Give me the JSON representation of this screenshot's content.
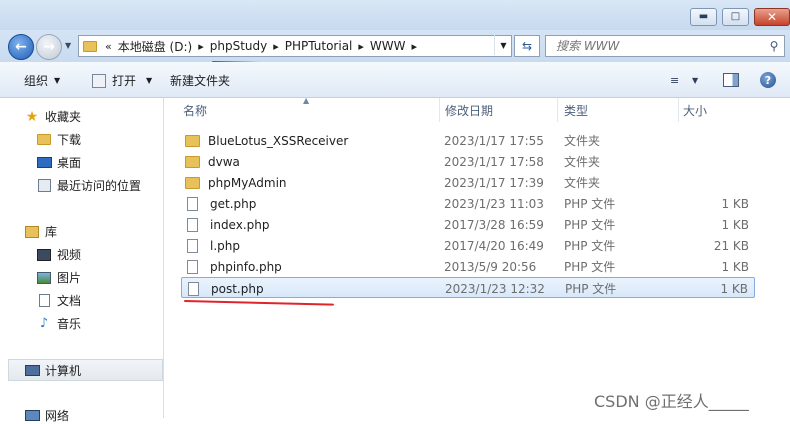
{
  "titlebar": {
    "buttons": {
      "minimize": "▬",
      "maximize": "□",
      "close": "✕"
    }
  },
  "nav": {
    "back_glyph": "←",
    "forward_glyph": "→",
    "recent_glyph": "▼",
    "crumbs_prefix": "«",
    "crumbs": [
      "本地磁盘 (D:)",
      "phpStudy",
      "PHPTutorial",
      "WWW"
    ],
    "crumb_separator": "▸",
    "dropdown_glyph": "▼",
    "refresh_glyph": "⇆"
  },
  "search": {
    "placeholder": "搜索 WWW",
    "icon": "search-icon",
    "icon_glyph": "⚲"
  },
  "toolbar": {
    "organize_label": "组织",
    "open_label": "打开",
    "new_folder_label": "新建文件夹",
    "dropdown_glyph": "▼",
    "view_glyph": "≡",
    "help_glyph": "?"
  },
  "sidebar": {
    "favorites": {
      "label": "收藏夹",
      "items": [
        "下载",
        "桌面",
        "最近访问的位置"
      ]
    },
    "libraries": {
      "label": "库",
      "items": [
        "视频",
        "图片",
        "文档",
        "音乐"
      ]
    },
    "computer": {
      "label": "计算机"
    },
    "network": {
      "label": "网络"
    }
  },
  "columns": {
    "name": "名称",
    "date": "修改日期",
    "type": "类型",
    "size": "大小",
    "sort_glyph": "▲"
  },
  "files": [
    {
      "name": "BlueLotus_XSSReceiver",
      "date": "2023/1/17 17:55",
      "type": "文件夹",
      "size": "",
      "kind": "folder"
    },
    {
      "name": "dvwa",
      "date": "2023/1/17 17:58",
      "type": "文件夹",
      "size": "",
      "kind": "folder"
    },
    {
      "name": "phpMyAdmin",
      "date": "2023/1/17 17:39",
      "type": "文件夹",
      "size": "",
      "kind": "folder"
    },
    {
      "name": "get.php",
      "date": "2023/1/23 11:03",
      "type": "PHP 文件",
      "size": "1 KB",
      "kind": "file"
    },
    {
      "name": "index.php",
      "date": "2017/3/28 16:59",
      "type": "PHP 文件",
      "size": "1 KB",
      "kind": "file"
    },
    {
      "name": "l.php",
      "date": "2017/4/20 16:49",
      "type": "PHP 文件",
      "size": "21 KB",
      "kind": "file"
    },
    {
      "name": "phpinfo.php",
      "date": "2013/5/9 20:56",
      "type": "PHP 文件",
      "size": "1 KB",
      "kind": "file"
    },
    {
      "name": "post.php",
      "date": "2023/1/23 12:32",
      "type": "PHP 文件",
      "size": "1 KB",
      "kind": "file",
      "selected": true
    }
  ],
  "watermark": "CSDN @正经人_____",
  "colors": {
    "annotation_red": "#e0242b",
    "selection_border": "#84acdd",
    "toolbar_bg": "#dfe9f5"
  }
}
